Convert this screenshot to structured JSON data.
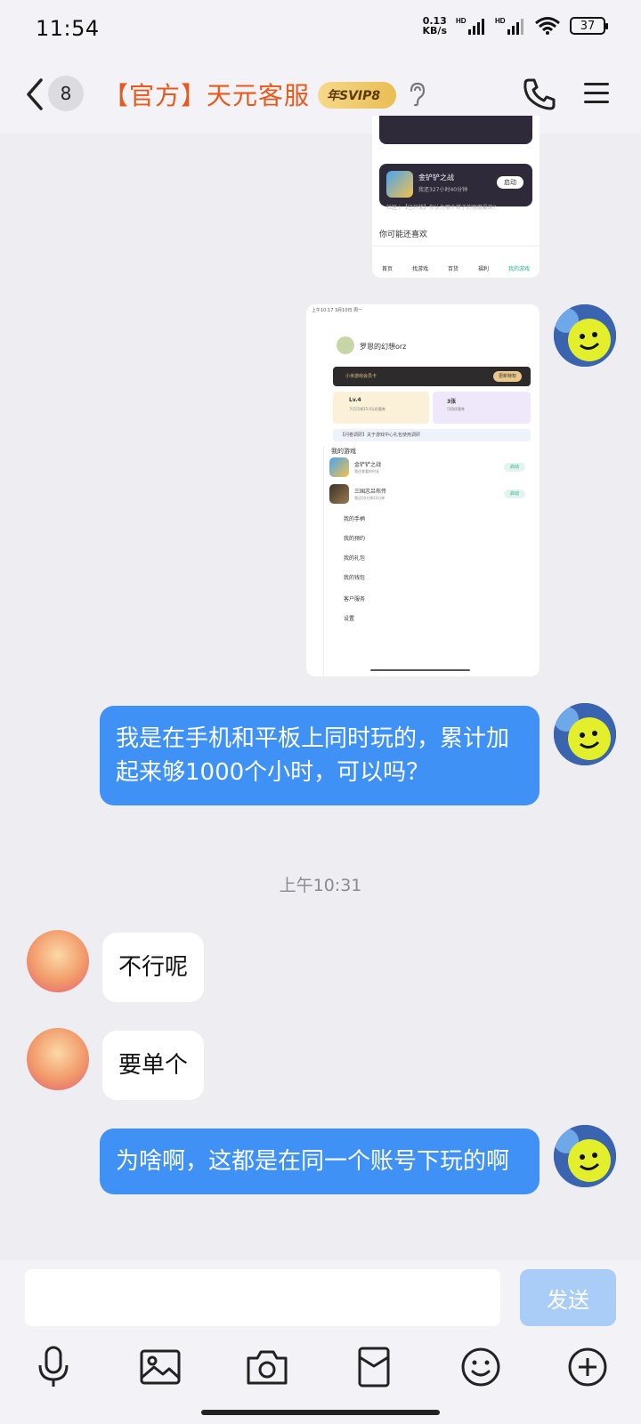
{
  "status": {
    "time": "11:54",
    "speed_value": "0.13",
    "speed_unit": "KB/s",
    "battery": "37"
  },
  "header": {
    "unread_count": "8",
    "title": "【官方】天元客服",
    "vip_badge": "年SVIP8"
  },
  "screenshot_top": {
    "game_name": "金铲铲之战",
    "game_sub": "我还327小时40分钟",
    "game_btn": "启动",
    "community": "社区 | 【已开奖】你认为哪个棋子的强度最高?",
    "recommend": "你可能还喜欢",
    "tabs": [
      "首页",
      "找游戏",
      "百货",
      "福利",
      "我的游戏"
    ]
  },
  "screenshot_main": {
    "statusline": "上午10:17 3月10日 周一",
    "username": "罗恩的幻想orz",
    "vip_card": "小米游戏会员卡",
    "vip_btn": "更新特权",
    "level": "Lv.4",
    "level_sub": "下月可领15.0元优惠券",
    "coupon": "3张",
    "coupon_sub": "可用优惠券",
    "survey": "【问卷调研】关于游戏中心礼包使用调研",
    "my_games": "我的游戏",
    "games": [
      {
        "name": "金铲铲之战",
        "sub": "我还查看的时长",
        "btn": "启动"
      },
      {
        "name": "三国志吕布传",
        "sub": "我还50分钟23分钟",
        "btn": "启动"
      }
    ],
    "menu": [
      "我的手柄",
      "我的预约",
      "我的礼包",
      "我的钱包",
      "客户服务",
      "设置"
    ]
  },
  "messages": [
    {
      "text": "我是在手机和平板上同时玩的，累计加起来够1000个小时，可以吗？"
    },
    {
      "text": "不行呢"
    },
    {
      "text": "要单个"
    },
    {
      "text": "为啥啊，这都是在同一个账号下玩的啊"
    }
  ],
  "timestamp": "上午10:31",
  "composer": {
    "send_label": "发送"
  },
  "toolbar": [
    "microphone-icon",
    "image-icon",
    "camera-icon",
    "red-packet-icon",
    "emoji-icon",
    "plus-icon"
  ]
}
